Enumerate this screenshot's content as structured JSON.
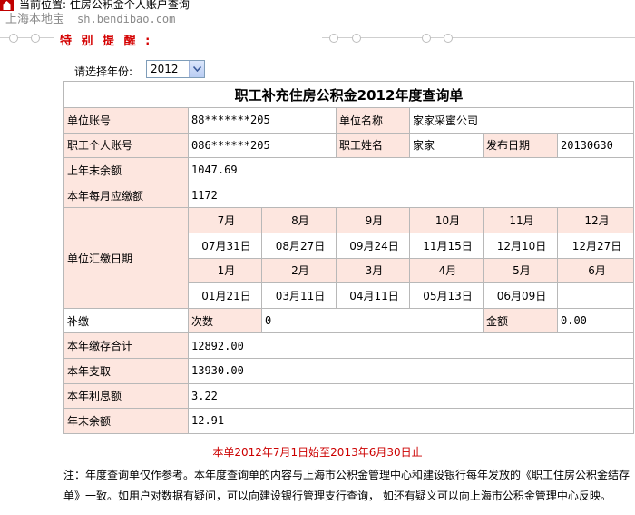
{
  "header": {
    "breadcrumb": "当前位置: 住房公积金个人账户查询",
    "site_name": "上海本地宝",
    "site_url": "sh.bendibao.com"
  },
  "notice_title": "特 别 提 醒 :",
  "year_filter": {
    "label": "请选择年份:",
    "value": "2012"
  },
  "table": {
    "title": "职工补充住房公积金2012年度查询单",
    "unit_account_label": "单位账号",
    "unit_account_value": "88*******205",
    "unit_name_label": "单位名称",
    "unit_name_value": "家家采蜜公司",
    "personal_account_label": "职工个人账号",
    "personal_account_value": "086******205",
    "employee_name_label": "职工姓名",
    "employee_name_value": "家家",
    "publish_date_label": "发布日期",
    "publish_date_value": "20130630",
    "prev_balance_label": "上年末余额",
    "prev_balance_value": "1047.69",
    "monthly_due_label": "本年每月应缴额",
    "monthly_due_value": "1172",
    "remit_dates_label": "单位汇缴日期",
    "months_row1": [
      "7月",
      "8月",
      "9月",
      "10月",
      "11月",
      "12月"
    ],
    "dates_row1": [
      "07月31日",
      "08月27日",
      "09月24日",
      "11月15日",
      "12月10日",
      "12月27日"
    ],
    "months_row2": [
      "1月",
      "2月",
      "3月",
      "4月",
      "5月",
      "6月"
    ],
    "dates_row2": [
      "01月21日",
      "03月11日",
      "04月11日",
      "05月13日",
      "06月09日",
      ""
    ],
    "supplement_label": "补缴",
    "times_label": "次数",
    "times_value": "0",
    "amount_label": "金额",
    "amount_value": "0.00",
    "year_deposit_label": "本年缴存合计",
    "year_deposit_value": "12892.00",
    "year_withdraw_label": "本年支取",
    "year_withdraw_value": "13930.00",
    "year_interest_label": "本年利息额",
    "year_interest_value": "3.22",
    "year_end_balance_label": "年末余额",
    "year_end_balance_value": "12.91"
  },
  "period_note": "本单2012年7月1日始至2013年6月30日止",
  "footnote": "注：年度查询单仅作参考。本年度查询单的内容与上海市公积金管理中心和建设银行每年发放的《职工住房公积金结存单》一致。如用户对数据有疑问，可以向建设银行管理支行查询， 如还有疑义可以向上海市公积金管理中心反映。",
  "colors": {
    "label_bg": "#fde6df",
    "accent_red": "#cc0000",
    "border": "#b8b8b8"
  }
}
